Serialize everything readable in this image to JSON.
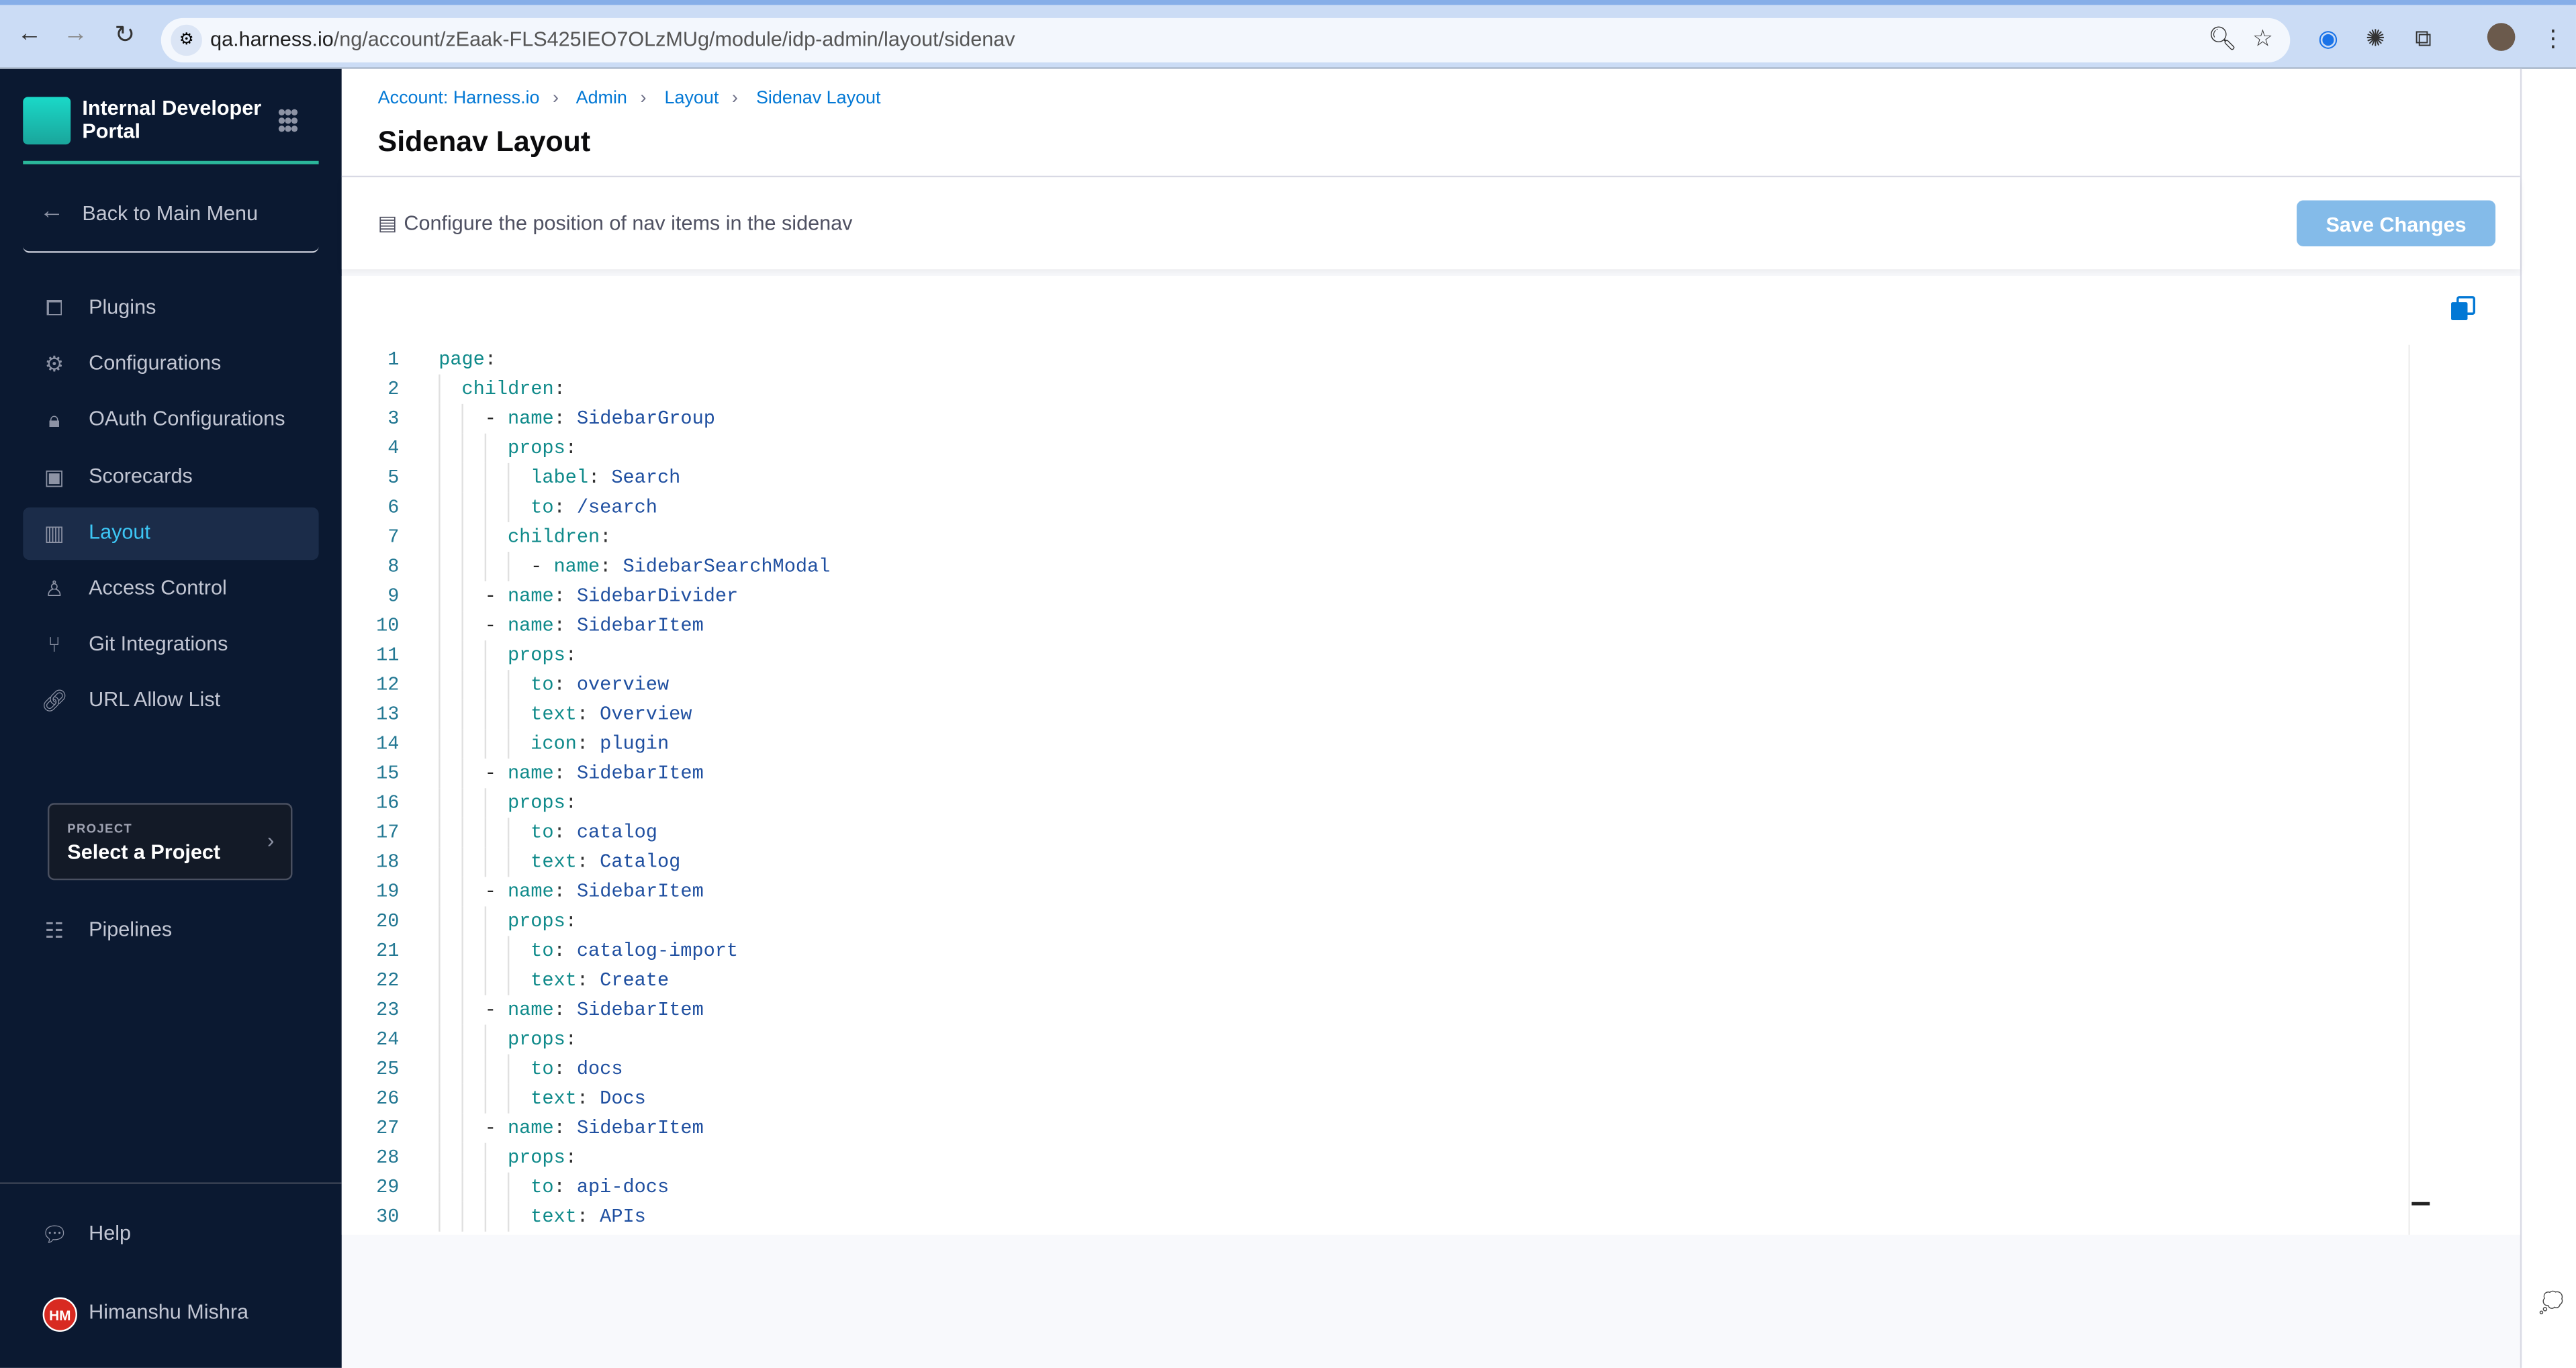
{
  "browser": {
    "url_host": "qa.harness.io",
    "url_path": "/ng/account/zEaak-FLS425IEO7OLzMUg/module/idp-admin/layout/sidenav"
  },
  "sidebar": {
    "product_title": "Internal Developer Portal",
    "back_label": "Back to Main Menu",
    "items": [
      {
        "label": "Plugins",
        "icon": "puzzle-icon"
      },
      {
        "label": "Configurations",
        "icon": "gears-icon"
      },
      {
        "label": "OAuth Configurations",
        "icon": "lock-icon"
      },
      {
        "label": "Scorecards",
        "icon": "scorecard-icon"
      },
      {
        "label": "Layout",
        "icon": "layout-icon",
        "active": true
      },
      {
        "label": "Access Control",
        "icon": "user-icon"
      },
      {
        "label": "Git Integrations",
        "icon": "git-icon"
      },
      {
        "label": "URL Allow List",
        "icon": "link-icon"
      }
    ],
    "project": {
      "caption": "PROJECT",
      "value": "Select a Project"
    },
    "pipelines_label": "Pipelines",
    "help_label": "Help",
    "user": {
      "initials": "HM",
      "name": "Himanshu Mishra"
    }
  },
  "header": {
    "breadcrumbs": [
      "Account: Harness.io",
      "Admin",
      "Layout",
      "Sidenav Layout"
    ],
    "title": "Sidenav Layout"
  },
  "toolbar": {
    "description": "Configure the position of nav items in the sidenav",
    "save_label": "Save Changes"
  },
  "editor": {
    "lines": [
      "page:",
      "  children:",
      "    - name: SidebarGroup",
      "      props:",
      "        label: Search",
      "        to: /search",
      "      children:",
      "        - name: SidebarSearchModal",
      "    - name: SidebarDivider",
      "    - name: SidebarItem",
      "      props:",
      "        to: overview",
      "        text: Overview",
      "        icon: plugin",
      "    - name: SidebarItem",
      "      props:",
      "        to: catalog",
      "        text: Catalog",
      "    - name: SidebarItem",
      "      props:",
      "        to: catalog-import",
      "        text: Create",
      "    - name: SidebarItem",
      "      props:",
      "        to: docs",
      "        text: Docs",
      "    - name: SidebarItem",
      "      props:",
      "        to: api-docs",
      "        text: APIs"
    ]
  },
  "colors": {
    "sidebar_bg": "#0b1931",
    "accent": "#0278d5",
    "active_nav": "#3dc7f6",
    "yaml_key": "#0f8a8a",
    "yaml_value": "#1f4fa0"
  }
}
